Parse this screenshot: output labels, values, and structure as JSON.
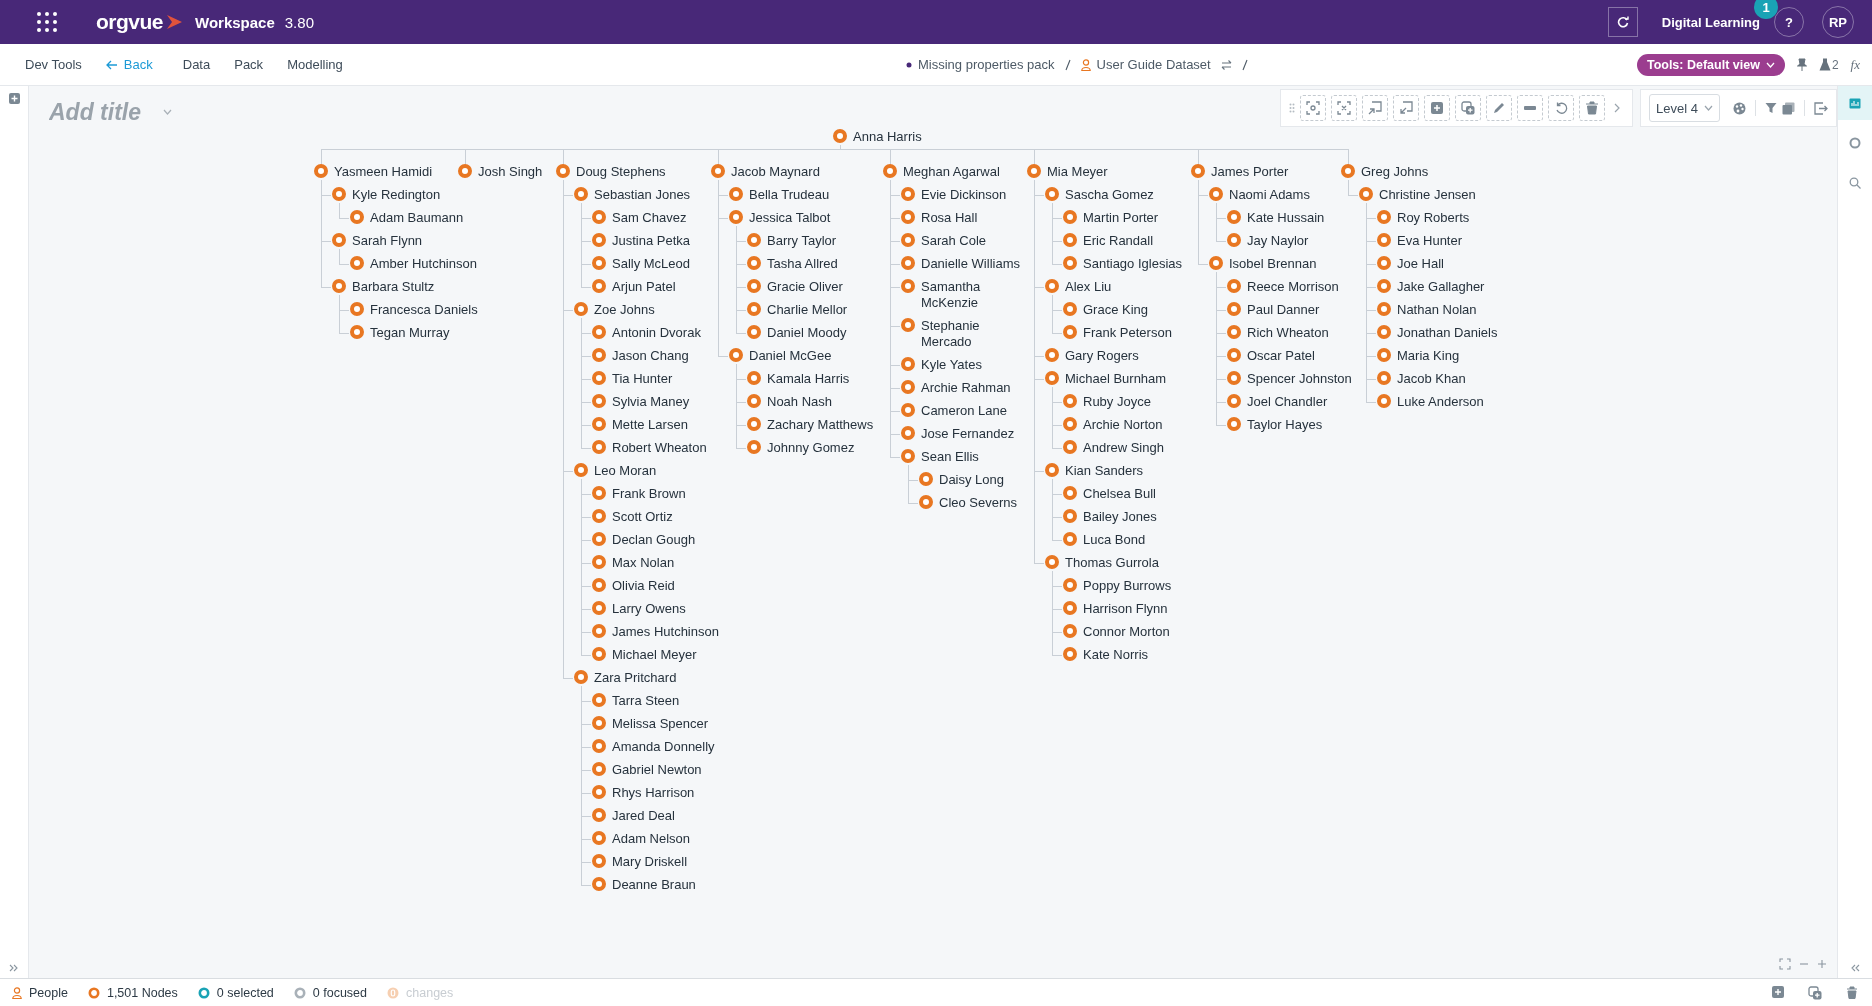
{
  "header": {
    "product": "orgvue",
    "workspace": "Workspace",
    "version": "3.80",
    "account": "Digital Learning",
    "notification_count": "1",
    "help": "?",
    "avatar": "RP"
  },
  "nav": [
    {
      "label": "Dev Tools",
      "kind": "plain"
    },
    {
      "label": "Back",
      "kind": "back"
    },
    {
      "label": "Data",
      "kind": "plain"
    },
    {
      "label": "Pack",
      "kind": "plain"
    },
    {
      "label": "Modelling",
      "kind": "plain"
    }
  ],
  "breadcrumb": [
    {
      "label": "Missing properties pack",
      "kind": "pack"
    },
    {
      "label": "User Guide Dataset",
      "kind": "dataset"
    }
  ],
  "tools": {
    "view": "Tools: Default view",
    "flask_count": "2",
    "formula": "fx"
  },
  "title": {
    "placeholder": "Add title"
  },
  "toolbar": {
    "level": "Level 4"
  },
  "sidebar_tabs": [
    {
      "kind": "chart",
      "selected": true
    },
    {
      "kind": "circle",
      "selected": false
    },
    {
      "kind": "search",
      "selected": false
    }
  ],
  "tree": {
    "name": "Anna Harris",
    "children": [
      {
        "name": "Yasmeen Hamidi",
        "children": [
          {
            "name": "Kyle Redington",
            "children": [
              {
                "name": "Adam Baumann"
              }
            ]
          },
          {
            "name": "Sarah Flynn",
            "children": [
              {
                "name": "Amber Hutchinson"
              }
            ]
          },
          {
            "name": "Barbara Stultz",
            "children": [
              {
                "name": "Francesca Daniels"
              },
              {
                "name": "Tegan Murray"
              }
            ]
          }
        ]
      },
      {
        "name": "Josh Singh"
      },
      {
        "name": "Doug Stephens",
        "children": [
          {
            "name": "Sebastian Jones",
            "children": [
              {
                "name": "Sam Chavez"
              },
              {
                "name": "Justina Petka"
              },
              {
                "name": "Sally McLeod"
              },
              {
                "name": "Arjun Patel"
              }
            ]
          },
          {
            "name": "Zoe Johns",
            "children": [
              {
                "name": "Antonin Dvorak"
              },
              {
                "name": "Jason Chang"
              },
              {
                "name": "Tia Hunter"
              },
              {
                "name": "Sylvia Maney"
              },
              {
                "name": "Mette Larsen"
              },
              {
                "name": "Robert Wheaton"
              }
            ]
          },
          {
            "name": "Leo Moran",
            "children": [
              {
                "name": "Frank Brown"
              },
              {
                "name": "Scott Ortiz"
              },
              {
                "name": "Declan Gough"
              },
              {
                "name": "Max Nolan"
              },
              {
                "name": "Olivia Reid"
              },
              {
                "name": "Larry Owens"
              },
              {
                "name": "James Hutchinson"
              },
              {
                "name": "Michael Meyer"
              }
            ]
          },
          {
            "name": "Zara Pritchard",
            "children": [
              {
                "name": "Tarra Steen"
              },
              {
                "name": "Melissa Spencer"
              },
              {
                "name": "Amanda Donnelly"
              },
              {
                "name": "Gabriel Newton"
              },
              {
                "name": "Rhys Harrison"
              },
              {
                "name": "Jared Deal"
              },
              {
                "name": "Adam Nelson"
              },
              {
                "name": "Mary Driskell"
              },
              {
                "name": "Deanne Braun"
              }
            ]
          }
        ]
      },
      {
        "name": "Jacob Maynard",
        "children": [
          {
            "name": "Bella Trudeau"
          },
          {
            "name": "Jessica Talbot",
            "children": [
              {
                "name": "Barry Taylor"
              },
              {
                "name": "Tasha Allred"
              },
              {
                "name": "Gracie Oliver"
              },
              {
                "name": "Charlie Mellor"
              },
              {
                "name": "Daniel Moody"
              }
            ]
          },
          {
            "name": "Daniel McGee",
            "children": [
              {
                "name": "Kamala Harris"
              },
              {
                "name": "Noah Nash"
              },
              {
                "name": "Zachary Matthews"
              },
              {
                "name": "Johnny Gomez"
              }
            ]
          }
        ]
      },
      {
        "name": "Meghan Agarwal",
        "children": [
          {
            "name": "Evie Dickinson"
          },
          {
            "name": "Rosa Hall"
          },
          {
            "name": "Sarah Cole"
          },
          {
            "name": "Danielle Williams"
          },
          {
            "name": "Samantha McKenzie"
          },
          {
            "name": "Stephanie Mercado"
          },
          {
            "name": "Kyle Yates"
          },
          {
            "name": "Archie Rahman"
          },
          {
            "name": "Cameron Lane"
          },
          {
            "name": "Jose Fernandez"
          },
          {
            "name": "Sean Ellis",
            "children": [
              {
                "name": "Daisy Long"
              },
              {
                "name": "Cleo Severns"
              }
            ]
          }
        ]
      },
      {
        "name": "Mia Meyer",
        "children": [
          {
            "name": "Sascha Gomez",
            "children": [
              {
                "name": "Martin Porter"
              },
              {
                "name": "Eric Randall"
              },
              {
                "name": "Santiago Iglesias"
              }
            ]
          },
          {
            "name": "Alex Liu",
            "children": [
              {
                "name": "Grace King"
              },
              {
                "name": "Frank Peterson"
              }
            ]
          },
          {
            "name": "Gary Rogers"
          },
          {
            "name": "Michael Burnham",
            "children": [
              {
                "name": "Ruby Joyce"
              },
              {
                "name": "Archie Norton"
              },
              {
                "name": "Andrew Singh"
              }
            ]
          },
          {
            "name": "Kian Sanders",
            "children": [
              {
                "name": "Chelsea Bull"
              },
              {
                "name": "Bailey Jones"
              },
              {
                "name": "Luca Bond"
              }
            ]
          },
          {
            "name": "Thomas Gurrola",
            "children": [
              {
                "name": "Poppy Burrows"
              },
              {
                "name": "Harrison Flynn"
              },
              {
                "name": "Connor Morton"
              },
              {
                "name": "Kate Norris"
              }
            ]
          }
        ]
      },
      {
        "name": "James Porter",
        "children": [
          {
            "name": "Naomi Adams",
            "children": [
              {
                "name": "Kate Hussain"
              },
              {
                "name": "Jay Naylor"
              }
            ]
          },
          {
            "name": "Isobel Brennan",
            "children": [
              {
                "name": "Reece Morrison"
              },
              {
                "name": "Paul Danner"
              },
              {
                "name": "Rich Wheaton"
              },
              {
                "name": "Oscar Patel"
              },
              {
                "name": "Spencer Johnston"
              },
              {
                "name": "Joel Chandler"
              },
              {
                "name": "Taylor Hayes"
              }
            ]
          }
        ]
      },
      {
        "name": "Greg Johns",
        "children": [
          {
            "name": "Christine Jensen",
            "children": [
              {
                "name": "Roy Roberts"
              },
              {
                "name": "Eva Hunter"
              },
              {
                "name": "Joe Hall"
              },
              {
                "name": "Jake Gallagher"
              },
              {
                "name": "Nathan Nolan"
              },
              {
                "name": "Jonathan Daniels"
              },
              {
                "name": "Maria King"
              },
              {
                "name": "Jacob Khan"
              },
              {
                "name": "Luke Anderson"
              }
            ]
          }
        ]
      }
    ]
  },
  "status_bar": [
    {
      "kind": "people",
      "label": "People",
      "disabled": false
    },
    {
      "kind": "nodes",
      "label": "1,501 Nodes",
      "disabled": false
    },
    {
      "kind": "selected",
      "label": "0 selected",
      "disabled": false
    },
    {
      "kind": "focused",
      "label": "0 focused",
      "disabled": false
    },
    {
      "kind": "changes",
      "label": "changes",
      "disabled": true
    }
  ]
}
